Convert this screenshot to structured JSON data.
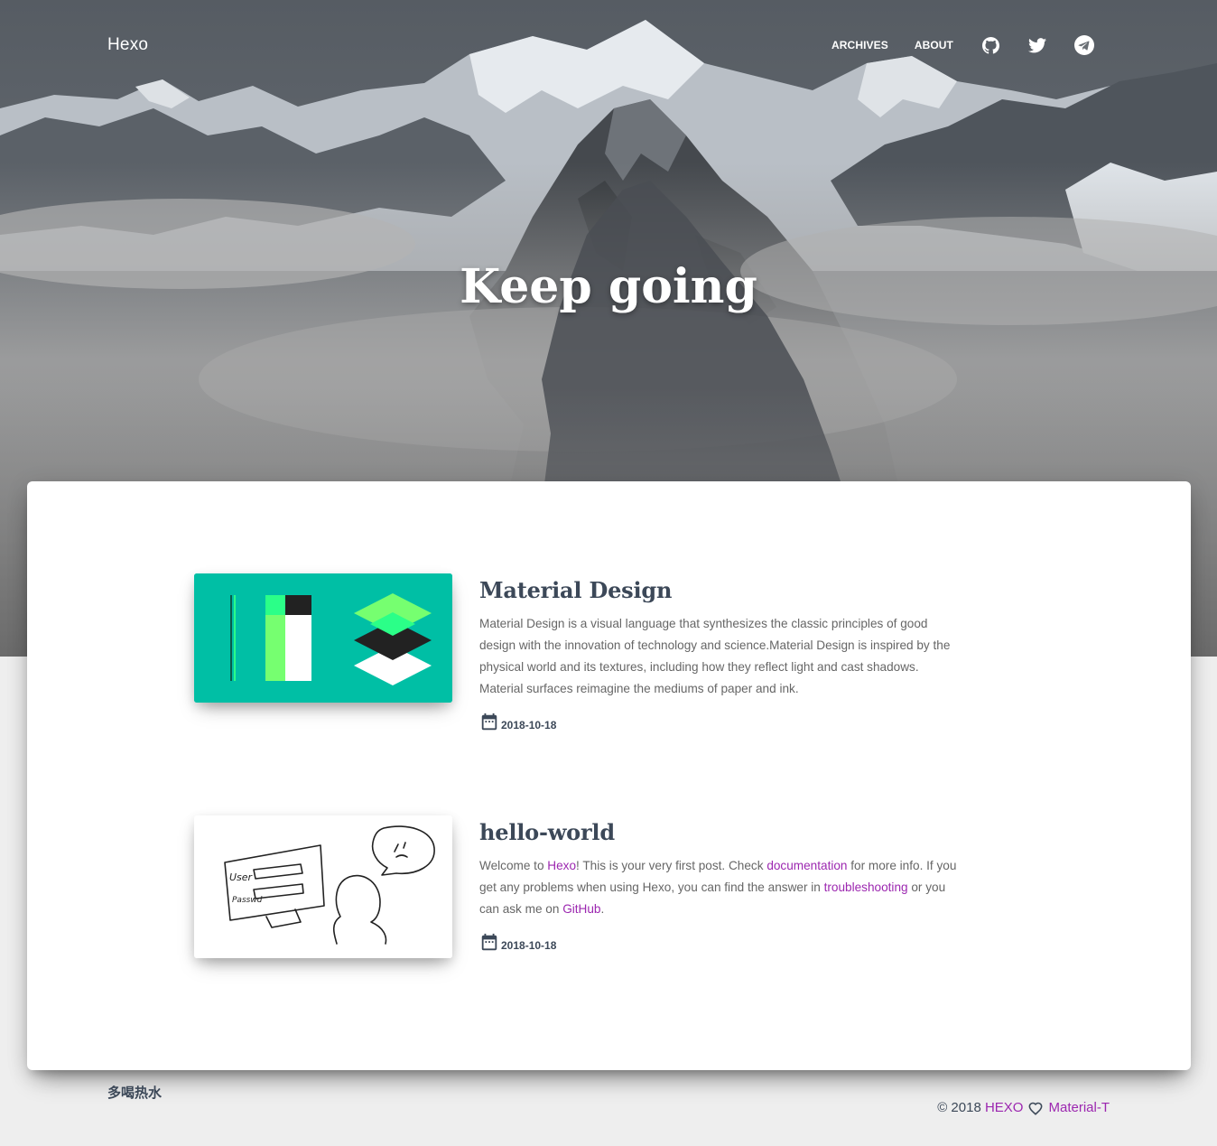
{
  "header": {
    "brand": "Hexo",
    "nav": [
      {
        "label": "ARCHIVES"
      },
      {
        "label": "ABOUT"
      }
    ],
    "icons": [
      "github-icon",
      "twitter-icon",
      "telegram-icon"
    ]
  },
  "hero": {
    "title": "Keep going"
  },
  "posts": [
    {
      "title": "Material Design",
      "excerpt": "Material Design is a visual language that synthesizes the classic principles of good design with the innovation of technology and science.Material Design is inspired by the physical world and its textures, including how they reflect light and cast shadows. Material surfaces reimagine the mediums of paper and ink.",
      "date": "2018-10-18",
      "thumb_color": "#00bfa5"
    },
    {
      "title": "hello-world",
      "excerpt_parts": {
        "t1": "Welcome to ",
        "link1": "Hexo",
        "t2": "! This is your very first post. Check ",
        "link2": "documentation",
        "t3": " for more info. If you get any problems when using Hexo, you can find the answer in ",
        "link3": "troubleshooting",
        "t4": " or you can ask me on ",
        "link4": "GitHub",
        "t5": "."
      },
      "date": "2018-10-18"
    }
  ],
  "footer": {
    "left_text": "多喝热水",
    "copyright": "© 2018",
    "link_hexo": "HEXO",
    "link_theme": "Material-T"
  },
  "colors": {
    "link": "#9c27b0",
    "text": "#3c4858",
    "page_bg": "#eeeeee"
  }
}
